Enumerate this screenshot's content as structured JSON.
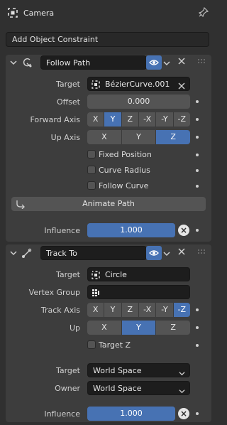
{
  "header": {
    "title": "Camera"
  },
  "add_constraint_label": "Add Object Constraint",
  "follow_path": {
    "name": "Follow Path",
    "target_label": "Target",
    "target_value": "BézierCurve.001",
    "offset_label": "Offset",
    "offset_value": "0.000",
    "forward_axis_label": "Forward Axis",
    "forward_axis_options": [
      "X",
      "Y",
      "Z",
      "-X",
      "-Y",
      "-Z"
    ],
    "forward_axis_selected": "Y",
    "up_axis_label": "Up Axis",
    "up_axis_options": [
      "X",
      "Y",
      "Z"
    ],
    "up_axis_selected": "Z",
    "fixed_position_label": "Fixed Position",
    "curve_radius_label": "Curve Radius",
    "follow_curve_label": "Follow Curve",
    "animate_path_label": "Animate Path",
    "influence_label": "Influence",
    "influence_value": "1.000",
    "influence_fraction": 1.0
  },
  "track_to": {
    "name": "Track To",
    "target_label": "Target",
    "target_value": "Circle",
    "vertex_group_label": "Vertex Group",
    "vertex_group_value": "",
    "track_axis_label": "Track Axis",
    "track_axis_options": [
      "X",
      "Y",
      "Z",
      "-X",
      "-Y",
      "-Z"
    ],
    "track_axis_selected": "-Z",
    "up_label": "Up",
    "up_options": [
      "X",
      "Y",
      "Z"
    ],
    "up_selected": "Y",
    "target_z_label": "Target Z",
    "target_space_label": "Target",
    "target_space_value": "World Space",
    "owner_space_label": "Owner",
    "owner_space_value": "World Space",
    "influence_label": "Influence",
    "influence_value": "1.000",
    "influence_fraction": 1.0
  },
  "colors": {
    "accent": "#4772b3",
    "panel": "#3d3d3d",
    "background": "#303030",
    "field": "#1d1d1d"
  }
}
